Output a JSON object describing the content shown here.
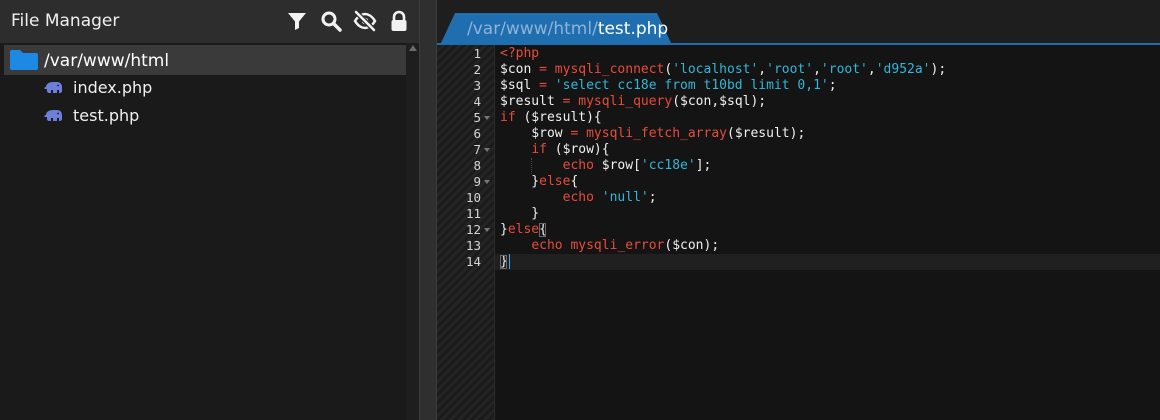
{
  "file_manager": {
    "title": "File Manager",
    "tools": [
      {
        "icon": "filter-icon"
      },
      {
        "icon": "search-icon"
      },
      {
        "icon": "eye-slash-icon"
      },
      {
        "icon": "lock-icon"
      }
    ],
    "root": {
      "label": "/var/www/html",
      "icon": "folder-icon"
    },
    "files": [
      {
        "label": "index.php",
        "icon": "php-elephant-icon"
      },
      {
        "label": "test.php",
        "icon": "php-elephant-icon"
      }
    ]
  },
  "editor": {
    "tab": {
      "dir": "/var/www/html/",
      "name": "test.php"
    },
    "line_numbers": [
      "1",
      "2",
      "3",
      "4",
      "5",
      "6",
      "7",
      "8",
      "9",
      "10",
      "11",
      "12",
      "13",
      "14"
    ],
    "lines": [
      [
        {
          "t": "<?php",
          "c": "kw"
        }
      ],
      [
        {
          "t": "$con",
          "c": "var"
        },
        {
          "t": " = ",
          "c": "kw"
        },
        {
          "t": "mysqli_connect",
          "c": "fn"
        },
        {
          "t": "(",
          "c": "pun"
        },
        {
          "t": "'localhost'",
          "c": "str"
        },
        {
          "t": ",",
          "c": "pun"
        },
        {
          "t": "'root'",
          "c": "str"
        },
        {
          "t": ",",
          "c": "pun"
        },
        {
          "t": "'root'",
          "c": "str"
        },
        {
          "t": ",",
          "c": "pun"
        },
        {
          "t": "'d952a'",
          "c": "str"
        },
        {
          "t": ");",
          "c": "pun"
        }
      ],
      [
        {
          "t": "$sql",
          "c": "var"
        },
        {
          "t": " = ",
          "c": "kw"
        },
        {
          "t": "'select cc18e from t10bd limit 0,1'",
          "c": "str"
        },
        {
          "t": ";",
          "c": "pun"
        }
      ],
      [
        {
          "t": "$result",
          "c": "var"
        },
        {
          "t": " = ",
          "c": "kw"
        },
        {
          "t": "mysqli_query",
          "c": "fn"
        },
        {
          "t": "($con,$sql);",
          "c": "pun"
        }
      ],
      [
        {
          "t": "if",
          "c": "kw"
        },
        {
          "t": " ($result){",
          "c": "pun"
        }
      ],
      [
        {
          "t": "    $row",
          "c": "var"
        },
        {
          "t": " = ",
          "c": "kw"
        },
        {
          "t": "mysqli_fetch_array",
          "c": "fn"
        },
        {
          "t": "($result);",
          "c": "pun"
        }
      ],
      [
        {
          "t": "    ",
          "c": "pun"
        },
        {
          "t": "if",
          "c": "kw"
        },
        {
          "t": " ($row){",
          "c": "pun"
        }
      ],
      [
        {
          "t": "        ",
          "c": "pun"
        },
        {
          "t": "echo",
          "c": "kw"
        },
        {
          "t": " $row[",
          "c": "pun"
        },
        {
          "t": "'cc18e'",
          "c": "str"
        },
        {
          "t": "];",
          "c": "pun"
        }
      ],
      [
        {
          "t": "    }",
          "c": "pun"
        },
        {
          "t": "else",
          "c": "kw"
        },
        {
          "t": "{",
          "c": "pun"
        }
      ],
      [
        {
          "t": "        ",
          "c": "pun"
        },
        {
          "t": "echo",
          "c": "kw"
        },
        {
          "t": " ",
          "c": "pun"
        },
        {
          "t": "'null'",
          "c": "str"
        },
        {
          "t": ";",
          "c": "pun"
        }
      ],
      [
        {
          "t": "    }",
          "c": "pun"
        }
      ],
      [
        {
          "t": "}",
          "c": "pun"
        },
        {
          "t": "else",
          "c": "kw"
        },
        {
          "t": "{",
          "c": "pun"
        }
      ],
      [
        {
          "t": "    ",
          "c": "pun"
        },
        {
          "t": "echo",
          "c": "kw"
        },
        {
          "t": " ",
          "c": "pun"
        },
        {
          "t": "mysqli_error",
          "c": "fn"
        },
        {
          "t": "($con);",
          "c": "pun"
        }
      ],
      [
        {
          "t": "}",
          "c": "pun"
        }
      ]
    ],
    "fold_lines": [
      5,
      7,
      9,
      12
    ]
  },
  "colors": {
    "accent": "#1f6fb0",
    "folder": "#1e88e5",
    "keyword": "#e74c3c",
    "string": "#32b7d8"
  }
}
